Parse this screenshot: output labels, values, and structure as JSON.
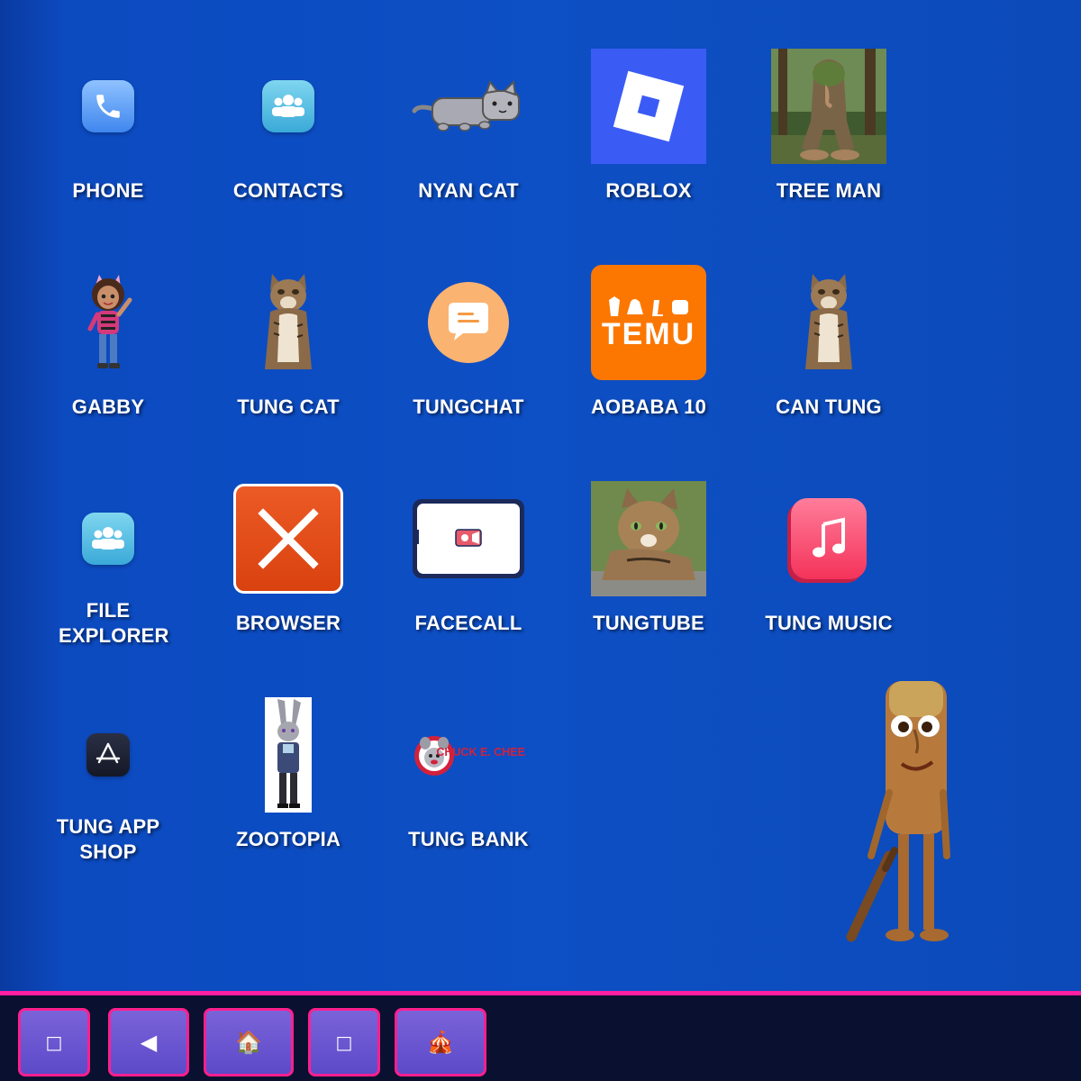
{
  "apps": [
    {
      "id": "phone",
      "label": "PHONE",
      "icon": "phone-icon"
    },
    {
      "id": "contacts",
      "label": "CONTACTS",
      "icon": "contacts-icon"
    },
    {
      "id": "nyan-cat",
      "label": "NYAN CAT",
      "icon": "nyan-cat-icon"
    },
    {
      "id": "roblox",
      "label": "ROBLOX",
      "icon": "roblox-icon"
    },
    {
      "id": "tree-man",
      "label": "TREE MAN",
      "icon": "tree-man-icon"
    },
    {
      "id": "gabby",
      "label": "GABBY",
      "icon": "gabby-icon"
    },
    {
      "id": "tung-cat",
      "label": "TUNG CAT",
      "icon": "tung-cat-icon"
    },
    {
      "id": "tungchat",
      "label": "TUNGCHAT",
      "icon": "chat-bubble-icon"
    },
    {
      "id": "aobaba-10",
      "label": "AOBABA 10",
      "icon": "temu-icon",
      "icon_text": "TEMU"
    },
    {
      "id": "can-tung",
      "label": "CAN TUNG",
      "icon": "can-tung-icon"
    },
    {
      "id": "file-explorer",
      "label": "FILE EXPLORER",
      "icon": "file-explorer-icon"
    },
    {
      "id": "browser",
      "label": "BROWSER",
      "icon": "browser-x-icon"
    },
    {
      "id": "facecall",
      "label": "FACECALL",
      "icon": "facecall-icon"
    },
    {
      "id": "tungtube",
      "label": "TUNGTUBE",
      "icon": "tungtube-icon"
    },
    {
      "id": "tung-music",
      "label": "TUNG MUSIC",
      "icon": "music-note-icon"
    },
    {
      "id": "tung-app-shop",
      "label": "TUNG APP SHOP",
      "icon": "app-store-icon"
    },
    {
      "id": "zootopia",
      "label": "ZOOTOPIA",
      "icon": "zootopia-icon"
    },
    {
      "id": "tung-bank",
      "label": "TUNG BANK",
      "icon": "chuck-e-cheese-icon",
      "icon_text": "CHUCK E. CHEESE"
    }
  ],
  "taskbar": {
    "buttons": [
      {
        "id": "tb-1",
        "glyph": "□",
        "icon": "placeholder-icon"
      },
      {
        "id": "tb-back",
        "glyph": "◀",
        "icon": "back-arrow-icon"
      },
      {
        "id": "tb-home",
        "glyph": "🏠",
        "icon": "home-icon"
      },
      {
        "id": "tb-4",
        "glyph": "□",
        "icon": "placeholder-icon"
      },
      {
        "id": "tb-circus",
        "glyph": "🎪",
        "icon": "circus-tent-icon"
      }
    ]
  },
  "colors": {
    "background": "#0d4fc4",
    "taskbar": "#0a1030",
    "taskbar_accent": "#ff1fa0",
    "button": "#6a56d0"
  }
}
